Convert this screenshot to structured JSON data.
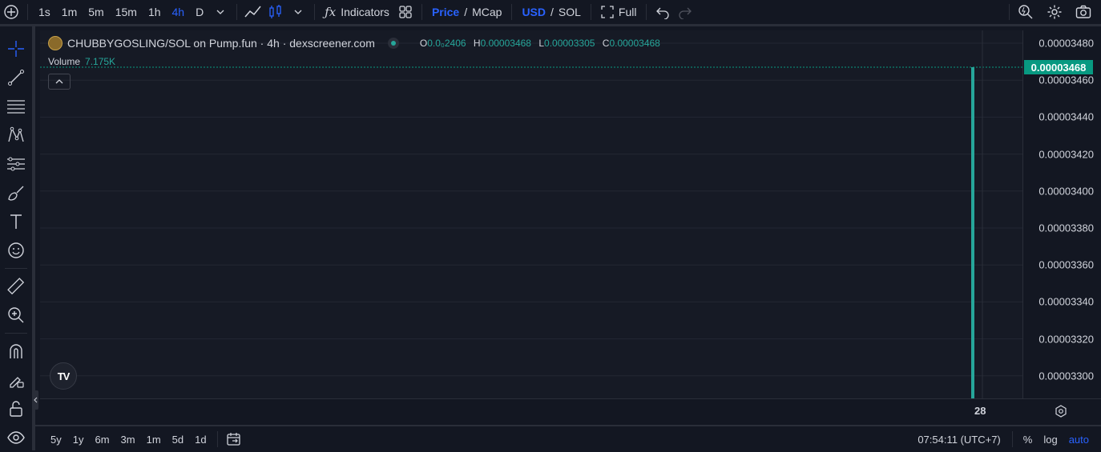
{
  "toolbar": {
    "timeframes": [
      {
        "label": "1s",
        "active": false
      },
      {
        "label": "1m",
        "active": false
      },
      {
        "label": "5m",
        "active": false
      },
      {
        "label": "15m",
        "active": false
      },
      {
        "label": "1h",
        "active": false
      },
      {
        "label": "4h",
        "active": true
      },
      {
        "label": "D",
        "active": false
      }
    ],
    "indicators_label": "Indicators",
    "price_label": "Price",
    "slash1": "/",
    "mcap_label": "MCap",
    "usd_label": "USD",
    "slash2": "/",
    "sol_label": "SOL",
    "full_label": "Full"
  },
  "legend": {
    "title": "CHUBBYGOSLING/SOL on Pump.fun · 4h · dexscreener.com",
    "o_key": "O",
    "o_val": "0.0₀2406",
    "h_key": "H",
    "h_val": "0.00003468",
    "l_key": "L",
    "l_val": "0.00003305",
    "c_key": "C",
    "c_val": "0.00003468",
    "volume_label": "Volume",
    "volume_val": "7.175K"
  },
  "price_axis": {
    "ticks": [
      "0.00003480",
      "0.00003460",
      "0.00003440",
      "0.00003420",
      "0.00003400",
      "0.00003380",
      "0.00003360",
      "0.00003340",
      "0.00003320",
      "0.00003300"
    ],
    "last_price": "0.00003468"
  },
  "time_axis": {
    "label": "28"
  },
  "bottom": {
    "ranges": [
      "5y",
      "1y",
      "6m",
      "3m",
      "1m",
      "5d",
      "1d"
    ],
    "clock": "07:54:11 (UTC+7)",
    "percent": "%",
    "log": "log",
    "auto": "auto"
  },
  "colors": {
    "accent": "#2962ff",
    "up": "#26a69a",
    "last": "#089981"
  }
}
